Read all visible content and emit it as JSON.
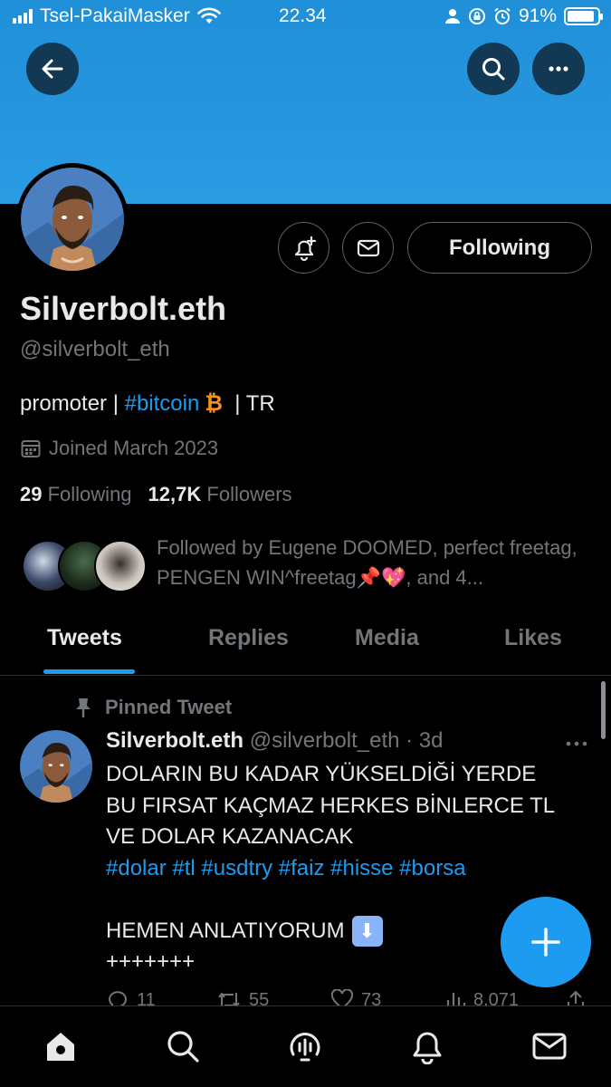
{
  "status_bar": {
    "carrier": "Tsel-PakaiMasker",
    "time": "22.34",
    "battery": "91%",
    "battery_level": 0.91
  },
  "header": {
    "back_icon": "arrow-left-icon",
    "search_icon": "search-icon",
    "more_icon": "more-horizontal-icon"
  },
  "profile": {
    "display_name": "Silverbolt.eth",
    "handle": "@silverbolt_eth",
    "bio_prefix": "promoter | ",
    "bio_hashtag": "#bitcoin",
    "bio_emoji": "₿",
    "bio_suffix": "  | TR",
    "joined": "Joined March 2023",
    "following_count": "29",
    "following_label": "Following",
    "followers_count": "12,7K",
    "followers_label": "Followers",
    "followed_by": "Followed by Eugene DOOMED, perfect freetag, PENGEN WIN^freetag📌💖, and 4...",
    "follow_button": "Following",
    "colors": {
      "accent": "#1d9bf0",
      "banner": "#2a9ce3",
      "muted": "#71767b"
    }
  },
  "tabs": [
    {
      "label": "Tweets",
      "active": true
    },
    {
      "label": "Replies",
      "active": false
    },
    {
      "label": "Media",
      "active": false
    },
    {
      "label": "Likes",
      "active": false
    }
  ],
  "tweet": {
    "pinned_label": "Pinned Tweet",
    "author": "Silverbolt.eth",
    "handle_time": "@silverbolt_eth · 3d",
    "lines": [
      "DOLARIN BU KADAR YÜKSELDİĞİ YERDE",
      "BU FIRSAT KAÇMAZ HERKES BİNLERCE TL",
      "VE DOLAR KAZANACAK"
    ],
    "hashtags": "#dolar #tl #usdtry #faiz #hisse #borsa",
    "line_after": "HEMEN ANLATIYORUM",
    "emoji": "⬇",
    "plus_line": "+++++++",
    "replies": "11",
    "retweets": "55",
    "likes": "73",
    "views": "8.071"
  },
  "bottom_nav": [
    "home-icon",
    "search-icon",
    "spaces-icon",
    "notifications-icon",
    "messages-icon"
  ]
}
